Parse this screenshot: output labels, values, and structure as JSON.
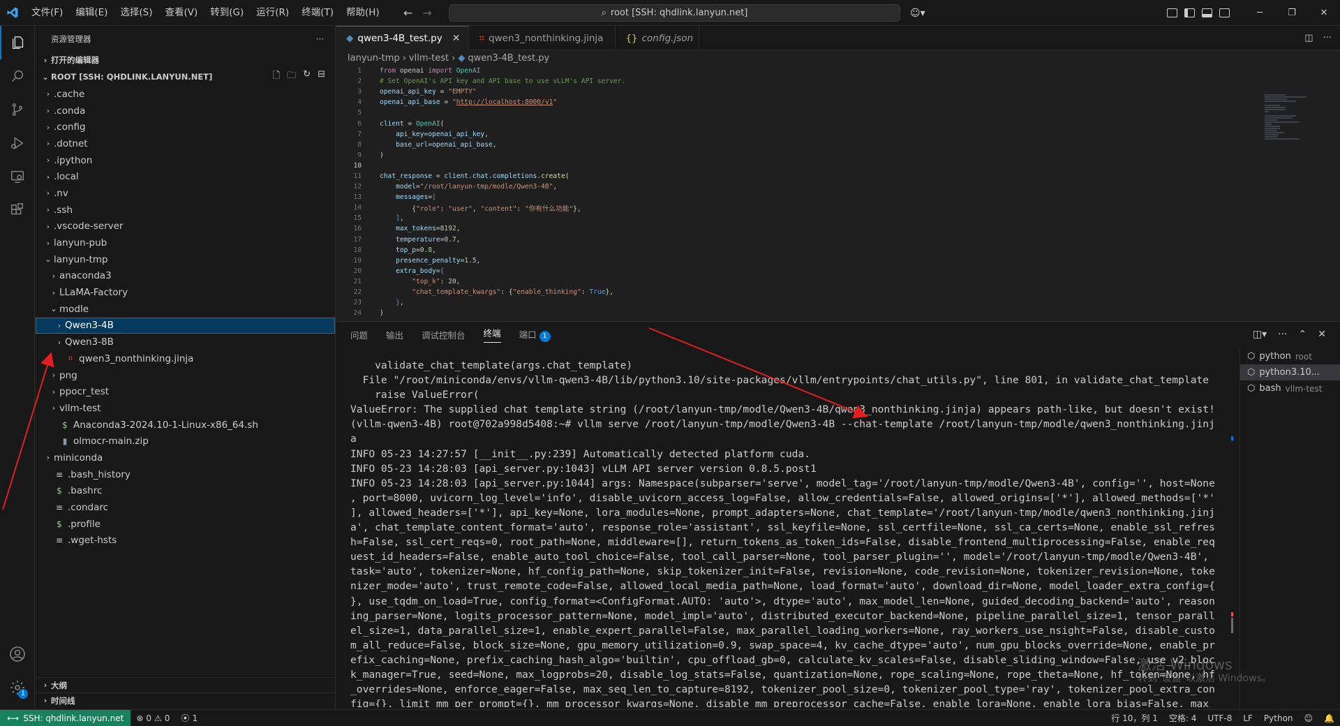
{
  "titlebar": {
    "menu": [
      "文件(F)",
      "编辑(E)",
      "选择(S)",
      "查看(V)",
      "转到(G)",
      "运行(R)",
      "终端(T)",
      "帮助(H)"
    ],
    "command_center": "root [SSH: qhdlink.lanyun.net]"
  },
  "sidebar": {
    "title": "资源管理器",
    "open_editors": "打开的编辑器",
    "root": "ROOT [SSH: QHDLINK.LANYUN.NET]",
    "items": [
      {
        "label": ".cache",
        "depth": 0,
        "type": "folder",
        "expanded": false
      },
      {
        "label": ".conda",
        "depth": 0,
        "type": "folder",
        "expanded": false
      },
      {
        "label": ".config",
        "depth": 0,
        "type": "folder",
        "expanded": false
      },
      {
        "label": ".dotnet",
        "depth": 0,
        "type": "folder",
        "expanded": false
      },
      {
        "label": ".ipython",
        "depth": 0,
        "type": "folder",
        "expanded": false
      },
      {
        "label": ".local",
        "depth": 0,
        "type": "folder",
        "expanded": false
      },
      {
        "label": ".nv",
        "depth": 0,
        "type": "folder",
        "expanded": false
      },
      {
        "label": ".ssh",
        "depth": 0,
        "type": "folder",
        "expanded": false
      },
      {
        "label": ".vscode-server",
        "depth": 0,
        "type": "folder",
        "expanded": false
      },
      {
        "label": "lanyun-pub",
        "depth": 0,
        "type": "folder",
        "expanded": false
      },
      {
        "label": "lanyun-tmp",
        "depth": 0,
        "type": "folder",
        "expanded": true
      },
      {
        "label": "anaconda3",
        "depth": 1,
        "type": "folder",
        "expanded": false
      },
      {
        "label": "LLaMA-Factory",
        "depth": 1,
        "type": "folder",
        "expanded": false
      },
      {
        "label": "modle",
        "depth": 1,
        "type": "folder",
        "expanded": true
      },
      {
        "label": "Qwen3-4B",
        "depth": 2,
        "type": "folder",
        "expanded": false,
        "selected": true
      },
      {
        "label": "Qwen3-8B",
        "depth": 2,
        "type": "folder",
        "expanded": false
      },
      {
        "label": "qwen3_nonthinking.jinja",
        "depth": 2,
        "type": "jinja"
      },
      {
        "label": "png",
        "depth": 1,
        "type": "folder",
        "expanded": false
      },
      {
        "label": "ppocr_test",
        "depth": 1,
        "type": "folder",
        "expanded": false
      },
      {
        "label": "vllm-test",
        "depth": 1,
        "type": "folder",
        "expanded": false
      },
      {
        "label": "Anaconda3-2024.10-1-Linux-x86_64.sh",
        "depth": 1,
        "type": "sh"
      },
      {
        "label": "olmocr-main.zip",
        "depth": 1,
        "type": "zip"
      },
      {
        "label": "miniconda",
        "depth": 0,
        "type": "folder",
        "expanded": false
      },
      {
        "label": ".bash_history",
        "depth": 0,
        "type": "text"
      },
      {
        "label": ".bashrc",
        "depth": 0,
        "type": "sh"
      },
      {
        "label": ".condarc",
        "depth": 0,
        "type": "text"
      },
      {
        "label": ".profile",
        "depth": 0,
        "type": "sh"
      },
      {
        "label": ".wget-hsts",
        "depth": 0,
        "type": "text"
      }
    ],
    "outline": "大纲",
    "timeline": "时间线"
  },
  "editor": {
    "tabs": [
      {
        "label": "qwen3-4B_test.py",
        "icon": "python-icon",
        "active": true
      },
      {
        "label": "qwen3_nonthinking.jinja",
        "icon": "jinja-icon",
        "active": false
      },
      {
        "label": "config.json",
        "icon": "json-icon",
        "active": false
      }
    ],
    "breadcrumb": [
      "lanyun-tmp",
      "vllm-test",
      "qwen3-4B_test.py"
    ],
    "current_line": 10
  },
  "panel": {
    "tabs": [
      "问题",
      "输出",
      "调试控制台",
      "终端",
      "端口"
    ],
    "active_tab": "终端",
    "ports_count": "1",
    "terminal_lines": [
      "    validate_chat_template(args.chat_template)",
      "  File \"/root/miniconda/envs/vllm-qwen3-4B/lib/python3.10/site-packages/vllm/entrypoints/chat_utils.py\", line 801, in validate_chat_template",
      "    raise ValueError(",
      "ValueError: The supplied chat template string (/root/lanyun-tmp/modle/Qwen3-4B/qwen3_nonthinking.jinja) appears path-like, but doesn't exist!",
      "(vllm-qwen3-4B) root@702a998d5408:~# vllm serve /root/lanyun-tmp/modle/Qwen3-4B --chat-template /root/lanyun-tmp/modle/qwen3_nonthinking.jinj",
      "a",
      "INFO 05-23 14:27:57 [__init__.py:239] Automatically detected platform cuda.",
      "INFO 05-23 14:28:03 [api_server.py:1043] vLLM API server version 0.8.5.post1",
      "INFO 05-23 14:28:03 [api_server.py:1044] args: Namespace(subparser='serve', model_tag='/root/lanyun-tmp/modle/Qwen3-4B', config='', host=None",
      ", port=8000, uvicorn_log_level='info', disable_uvicorn_access_log=False, allow_credentials=False, allowed_origins=['*'], allowed_methods=['*'",
      "], allowed_headers=['*'], api_key=None, lora_modules=None, prompt_adapters=None, chat_template='/root/lanyun-tmp/modle/qwen3_nonthinking.jinj",
      "a', chat_template_content_format='auto', response_role='assistant', ssl_keyfile=None, ssl_certfile=None, ssl_ca_certs=None, enable_ssl_refres",
      "h=False, ssl_cert_reqs=0, root_path=None, middleware=[], return_tokens_as_token_ids=False, disable_frontend_multiprocessing=False, enable_req",
      "uest_id_headers=False, enable_auto_tool_choice=False, tool_call_parser=None, tool_parser_plugin='', model='/root/lanyun-tmp/modle/Qwen3-4B',",
      "task='auto', tokenizer=None, hf_config_path=None, skip_tokenizer_init=False, revision=None, code_revision=None, tokenizer_revision=None, toke",
      "nizer_mode='auto', trust_remote_code=False, allowed_local_media_path=None, load_format='auto', download_dir=None, model_loader_extra_config={",
      "}, use_tqdm_on_load=True, config_format=<ConfigFormat.AUTO: 'auto'>, dtype='auto', max_model_len=None, guided_decoding_backend='auto', reason",
      "ing_parser=None, logits_processor_pattern=None, model_impl='auto', distributed_executor_backend=None, pipeline_parallel_size=1, tensor_parall",
      "el_size=1, data_parallel_size=1, enable_expert_parallel=False, max_parallel_loading_workers=None, ray_workers_use_nsight=False, disable_custo",
      "m_all_reduce=False, block_size=None, gpu_memory_utilization=0.9, swap_space=4, kv_cache_dtype='auto', num_gpu_blocks_override=None, enable_pr",
      "efix_caching=None, prefix_caching_hash_algo='builtin', cpu_offload_gb=0, calculate_kv_scales=False, disable_sliding_window=False, use_v2_bloc",
      "k_manager=True, seed=None, max_logprobs=20, disable_log_stats=False, quantization=None, rope_scaling=None, rope_theta=None, hf_token=None, hf",
      "_overrides=None, enforce_eager=False, max_seq_len_to_capture=8192, tokenizer_pool_size=0, tokenizer_pool_type='ray', tokenizer_pool_extra_con",
      "fig={}, limit_mm_per_prompt={}, mm_processor_kwargs=None, disable_mm_preprocessor_cache=False, enable_lora=None, enable_lora_bias=False, max_"
    ],
    "terminals": [
      {
        "name": "python",
        "sub": "root",
        "active": false
      },
      {
        "name": "python3.10...",
        "sub": "",
        "active": true
      },
      {
        "name": "bash",
        "sub": "vllm-test",
        "active": false
      }
    ]
  },
  "watermark": {
    "line1": "激活 Windows",
    "line2": "转到\"设置\"以激活 Windows。"
  },
  "statusbar": {
    "remote": "SSH: qhdlink.lanyun.net",
    "errors": "0",
    "warnings": "0",
    "ports": "1",
    "position": "行 10，列 1",
    "spaces": "空格: 4",
    "encoding": "UTF-8",
    "eol": "LF",
    "language": "Python"
  }
}
